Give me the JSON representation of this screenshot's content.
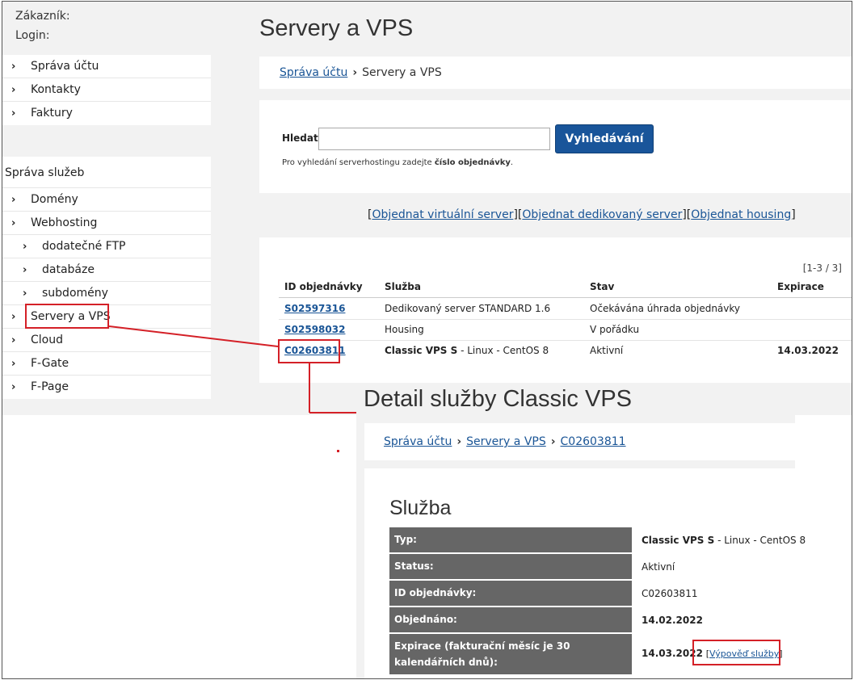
{
  "customer": {
    "zakaznik_label": "Zákazník:",
    "login_label": "Login:"
  },
  "account_nav": [
    {
      "label": "Správa účtu"
    },
    {
      "label": "Kontakty"
    },
    {
      "label": "Faktury"
    }
  ],
  "services_section_title": "Správa služeb",
  "services_nav": [
    {
      "label": "Domény"
    },
    {
      "label": "Webhosting"
    },
    {
      "label": "dodatečné FTP"
    },
    {
      "label": "databáze"
    },
    {
      "label": "subdomény"
    },
    {
      "label": "Servery a VPS"
    },
    {
      "label": "Cloud"
    },
    {
      "label": "F-Gate"
    },
    {
      "label": "F-Page"
    }
  ],
  "page_title": "Servery a VPS",
  "breadcrumb": {
    "parent": "Správa účtu",
    "current": "Servery a VPS"
  },
  "search": {
    "label": "Hledat",
    "value": "",
    "button": "Vyhledávání",
    "hint_prefix": "Pro vyhledání serverhostingu zadejte ",
    "hint_bold": "číslo objednávky",
    "hint_suffix": "."
  },
  "order_links": {
    "virtual": "Objednat virtuální server",
    "dedicated": "Objednat dedikovaný server",
    "housing": "Objednat housing"
  },
  "table": {
    "counter": "[1-3 / 3]",
    "headers": {
      "id": "ID objednávky",
      "service": "Služba",
      "status": "Stav",
      "expiry": "Expirace"
    },
    "rows": [
      {
        "id": "S02597316",
        "service_bold": "",
        "service": "Dedikovaný server STANDARD 1.6",
        "status": "Očekávána úhrada objednávky",
        "expiry": ""
      },
      {
        "id": "S02598032",
        "service_bold": "",
        "service": "Housing",
        "status": "V pořádku",
        "expiry": ""
      },
      {
        "id": "C02603811",
        "service_bold": "Classic VPS S",
        "service": " - Linux - CentOS 8",
        "status": "Aktivní",
        "expiry": "14.03.2022"
      }
    ]
  },
  "detail": {
    "title": "Detail služby Classic VPS",
    "breadcrumb": [
      "Správa účtu",
      "Servery a VPS",
      "C02603811"
    ],
    "section": "Služba",
    "fields": [
      {
        "label": "Typ:",
        "value_bold": "Classic VPS S",
        "value": " - Linux - CentOS 8"
      },
      {
        "label": "Status:",
        "value_bold": "",
        "value": "Aktivní"
      },
      {
        "label": "ID objednávky:",
        "value_bold": "",
        "value": "C02603811"
      },
      {
        "label": "Objednáno:",
        "value_bold": "14.02.2022",
        "value": ""
      },
      {
        "label": "Expirace (fakturační měsíc je 30 kalendářních dnů):",
        "value_bold": "14.03.2022",
        "value": ""
      }
    ],
    "cancel_link": "Výpověď služby"
  },
  "colors": {
    "accent": "#19559a",
    "link": "#1a5596",
    "annotation": "#d42027",
    "label_bg": "#666666"
  }
}
